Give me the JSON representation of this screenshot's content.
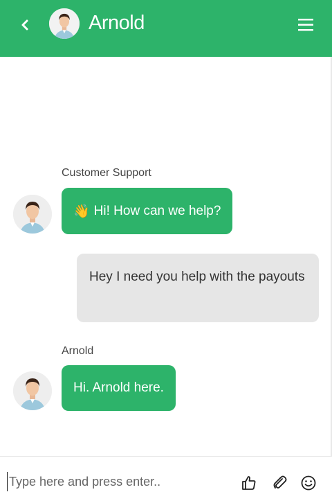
{
  "header": {
    "title": "Arnold",
    "back_icon": "chevron-left-icon",
    "menu_icon": "hamburger-menu-icon",
    "bg_color": "#2db36a"
  },
  "messages": [
    {
      "sender": "Customer Support",
      "emoji": "👋",
      "text": "Hi! How can we help?",
      "direction": "incoming"
    },
    {
      "text": "Hey I need you help with the payouts",
      "direction": "outgoing"
    },
    {
      "sender": "Arnold",
      "text": "Hi. Arnold here.",
      "direction": "incoming"
    }
  ],
  "composer": {
    "placeholder": "Type here and press enter..",
    "icons": [
      "thumbs-up-icon",
      "paperclip-icon",
      "smiley-icon"
    ]
  }
}
